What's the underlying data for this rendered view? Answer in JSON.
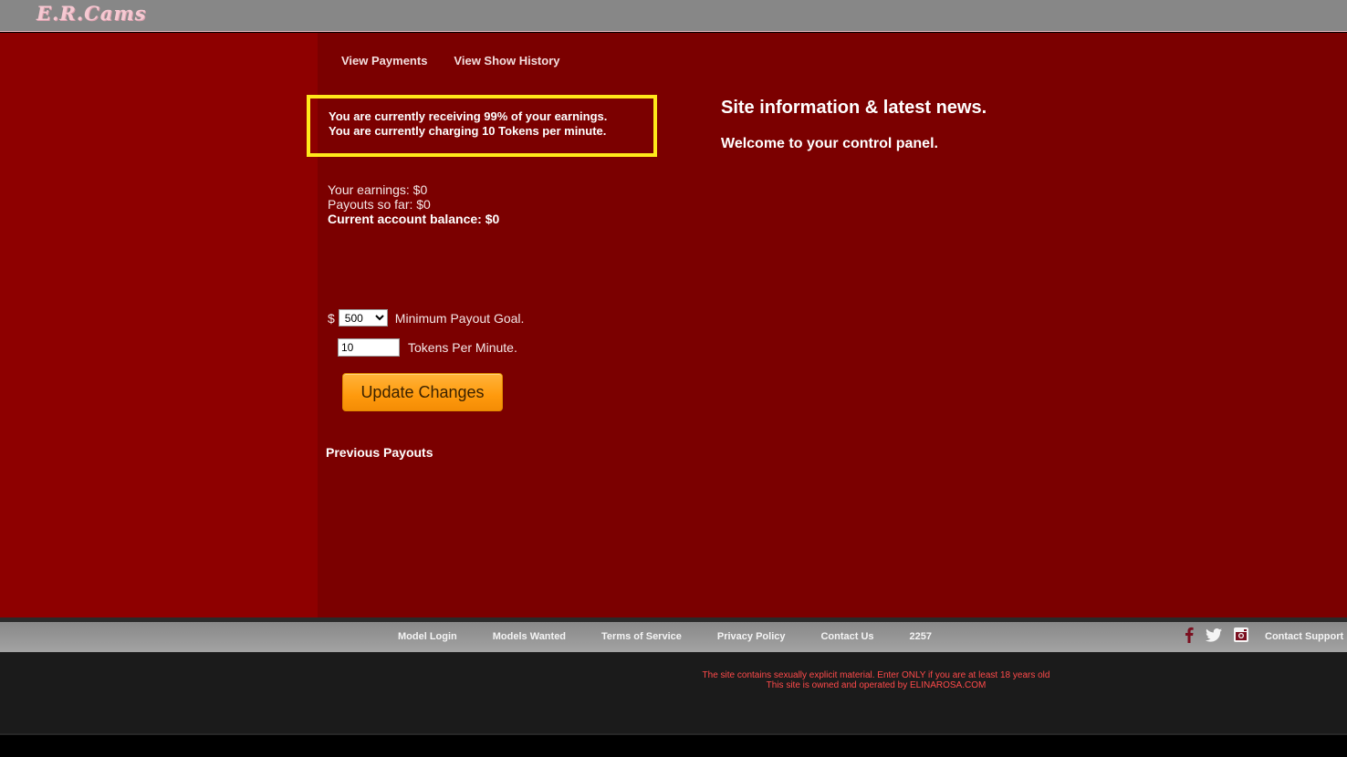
{
  "header": {
    "logo_text": "E.R.Cams"
  },
  "top_nav": [
    {
      "label": "View Payments"
    },
    {
      "label": "View Show History"
    }
  ],
  "notice": {
    "line1": "You are currently receiving 99% of your earnings.",
    "line2": "You are currently charging 10 Tokens per minute."
  },
  "account": {
    "earnings": "Your earnings: $0",
    "payouts": "Payouts so far: $0",
    "balance": "Current account balance: $0"
  },
  "form": {
    "currency_symbol": "$",
    "min_payout_selected": "500",
    "min_payout_label": "Minimum Payout Goal.",
    "tokens_value": "10",
    "tokens_label": "Tokens Per Minute.",
    "update_button": "Update Changes"
  },
  "previous_payouts": {
    "title": "Previous Payouts"
  },
  "news": {
    "title": "Site information & latest news.",
    "welcome": "Welcome to your control panel."
  },
  "footer": {
    "links": [
      {
        "label": "Model Login"
      },
      {
        "label": "Models Wanted"
      },
      {
        "label": "Terms of Service"
      },
      {
        "label": "Privacy Policy"
      },
      {
        "label": "Contact Us"
      },
      {
        "label": "2257"
      }
    ],
    "social_icons": [
      "facebook-icon",
      "twitter-icon",
      "instagram-icon"
    ],
    "contact_support": "Contact Support",
    "disclaimer_line1": "The site contains sexually explicit material. Enter ONLY if you are at least 18 years old",
    "disclaimer_line2": "This site is owned and operated by ELINAROSA.COM"
  },
  "colors": {
    "header_bg": "#878787",
    "left_panel": "#8e0000",
    "main_bg": "#7b0000",
    "notice_border": "#ffe81a",
    "button_orange": "#ff9a0d",
    "disclaimer_red": "#ff4a4a",
    "icon_maroon": "#7b1020"
  }
}
